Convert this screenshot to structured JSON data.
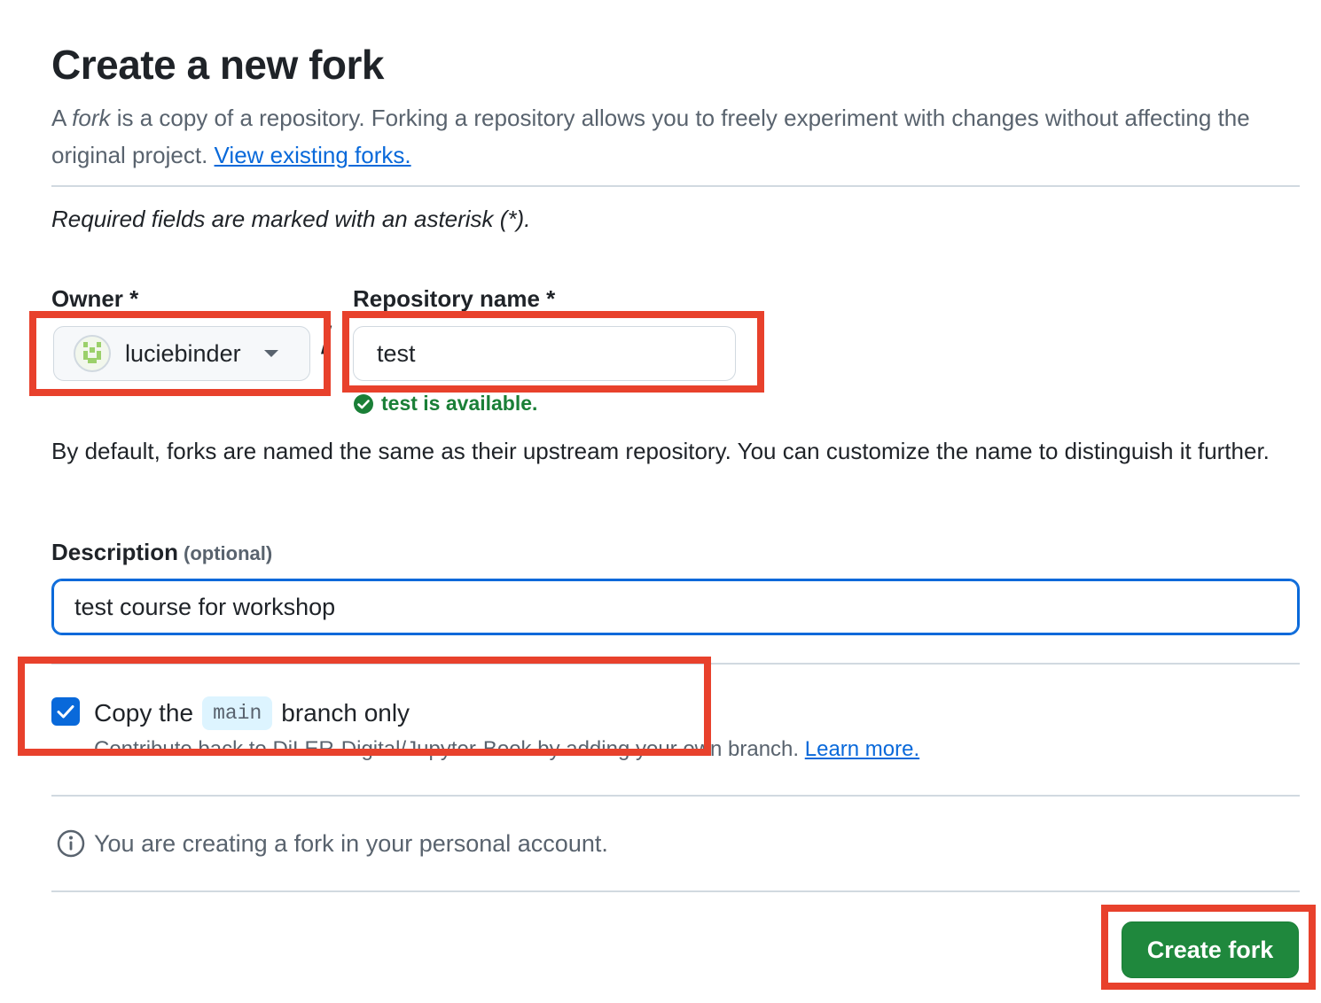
{
  "page": {
    "title": "Create a new fork",
    "intro_prefix": "A ",
    "intro_em": "fork",
    "intro_rest": " is a copy of a repository. Forking a repository allows you to freely experiment with changes without affecting the original project. ",
    "view_forks_link": "View existing forks.",
    "required_note": "Required fields are marked with an asterisk (*)."
  },
  "owner": {
    "label": "Owner *",
    "value": "luciebinder"
  },
  "separator": "/",
  "repo": {
    "label": "Repository name *",
    "value": "test",
    "availability": "test is available."
  },
  "naming_note": "By default, forks are named the same as their upstream repository. You can customize the name to distinguish it further.",
  "description": {
    "label": "Description",
    "optional": "(optional)",
    "value": "test course for workshop"
  },
  "copy_branch": {
    "checked": true,
    "prefix": "Copy the",
    "branch": "main",
    "suffix": "branch only",
    "subtext": "Contribute back to DiLER-Digital/Jupyter-Book by adding your own branch.",
    "learn_more": "Learn more."
  },
  "info_message": "You are creating a fork in your personal account.",
  "create_button": "Create fork",
  "colors": {
    "primary_button": "#1f883d",
    "link": "#0969da",
    "success": "#1a7f37",
    "highlight": "#e8412c"
  }
}
